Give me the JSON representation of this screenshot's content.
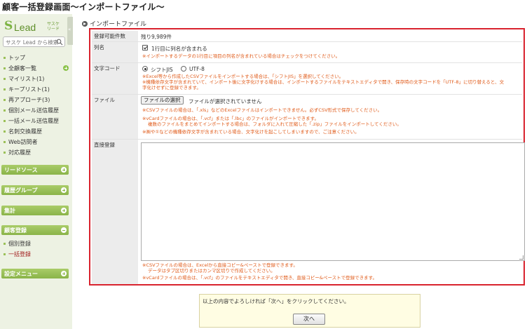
{
  "page_title": "顧客一括登録画面～インポートファイル～",
  "sidebar": {
    "logo_mark": "S",
    "logo_text": "Lead",
    "logo_sub1": "サスケ",
    "logo_sub2": "リード",
    "collapse_glyph": "«",
    "search_placeholder": "サスケ Lead から検索",
    "nav_items": [
      {
        "label": "トップ"
      },
      {
        "label": "全顧客一覧"
      },
      {
        "label": "マイリスト(1)"
      },
      {
        "label": "キープリスト(1)"
      },
      {
        "label": "再アプローチ(3)"
      },
      {
        "label": "個別メール送信履歴"
      },
      {
        "label": "一括メール送信履歴"
      },
      {
        "label": "名刺交換履歴"
      },
      {
        "label": "Web訪問者"
      },
      {
        "label": "対応履歴"
      }
    ],
    "sections": [
      {
        "label": "リードソース",
        "icon": "plus-icon"
      },
      {
        "label": "履歴グループ",
        "icon": "plus-icon"
      },
      {
        "label": "集計",
        "icon": "plus-icon"
      },
      {
        "label": "顧客登録",
        "icon": "minus-icon"
      },
      {
        "label": "設定メニュー",
        "icon": "plus-icon"
      }
    ],
    "sub_items": [
      {
        "label": "個別登録"
      },
      {
        "label": "一括登録"
      }
    ]
  },
  "content": {
    "section_title": "インポートファイル",
    "rows": {
      "count": {
        "label": "登録可能件数",
        "value": "残り9,989件"
      },
      "header": {
        "label": "列名",
        "checkbox_label": "1行目に列名が含まれる",
        "checked": true,
        "note": "※インポートするデータの1行目に項目の列名が含まれている場合はチェックをつけてください。"
      },
      "charcode": {
        "label": "文字コード",
        "option1": "シフトJIS",
        "option2": "UTF-8",
        "selected": "シフトJIS",
        "note1": "※Excel等から作成したCSVファイルをインポートする場合は、「シフトJIS」を選択してください。",
        "note2": "※機種依存文字が含まれていて、インポート後に文字化けする場合は、インポートするファイルをテキストエディタで開き、保存時の文字コードを「UTF-8」に切り替えると、文",
        "note3": "字化けせずに登録できます。"
      },
      "file": {
        "label": "ファイル",
        "button": "ファイルの選択",
        "status": "ファイルが選択されていません",
        "note1": "※CSVファイルの場合は、「.xls」などのExcelファイルはインポートできません。必ずCSV形式で保存してください。",
        "note2": "※vCardファイルの場合は、「.vcf」または「.lbc」のファイルがインポートできます。",
        "note3": "複数のファイルをまとめてインポートする場合は、フォルダに入れて圧縮した「.zip」ファイルをインポートしてください。",
        "note4": "※㈱や①などの機種依存文字が含まれている場合、文字化けを起こしてしまいますので、ご注意ください。"
      },
      "direct": {
        "label": "直接登録",
        "textarea_value": "",
        "note1": "※CSVファイルの場合は、Excelから直接コピー&ペーストで登録できます。",
        "note2": "データはタブ区切りまたはカンマ区切りで作成してください。",
        "note3": "※vCardファイルの場合は、「.vcf」のファイルをテキストエディタで開き、直接コピー&ペーストで登録できます。"
      }
    },
    "confirm": {
      "message": "以上の内容でよろしければ「次へ」をクリックしてください。",
      "next_button": "次へ"
    }
  },
  "colors": {
    "accent_green": "#8ab449",
    "highlight_border": "#d9232e",
    "note_orange": "#e05b1a"
  }
}
